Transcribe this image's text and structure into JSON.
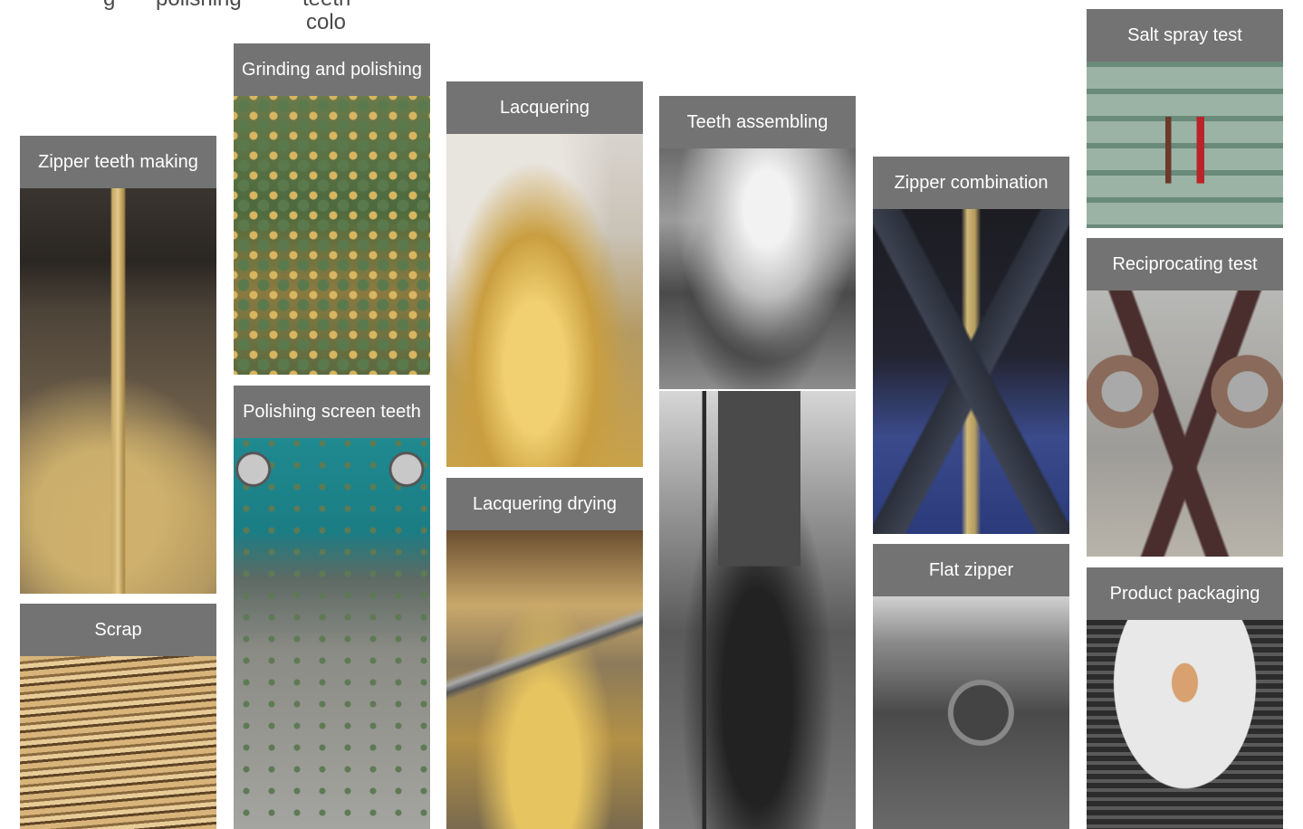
{
  "top_fragments": {
    "col1": "g",
    "col2": "polishing",
    "col3a": "teeth",
    "col3b": "colo"
  },
  "cards": {
    "zipper_teeth_making": "Zipper teeth making",
    "scrap": "Scrap",
    "grinding_and_polishing": "Grinding and polishing",
    "polishing_screen_teeth": "Polishing screen teeth",
    "lacquering": "Lacquering",
    "lacquering_drying": "Lacquering drying",
    "teeth_assembling": "Teeth assembling",
    "zipper_combination": "Zipper combination",
    "flat_zipper": "Flat zipper",
    "salt_spray_test": "Salt spray test",
    "reciprocating_test": "Reciprocating test",
    "product_packaging": "Product packaging"
  },
  "colors": {
    "label_background": "#737373",
    "label_text": "#ffffff",
    "page_background": "#ffffff"
  }
}
